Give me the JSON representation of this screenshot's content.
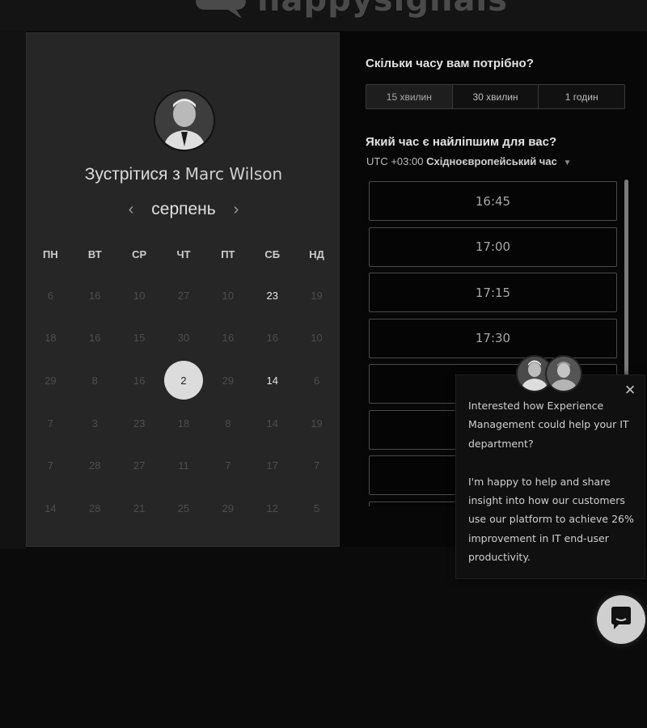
{
  "header": {
    "logo_text": "happysignals",
    "logo_icon": "speech-bubble-logo-icon"
  },
  "booking": {
    "title_prefix": "Зустрітися з",
    "host_name": "Marc Wilson",
    "month": "серпень",
    "prev_icon": "chevron-left-icon",
    "next_icon": "chevron-right-icon",
    "weekdays": [
      "ПН",
      "ВТ",
      "СР",
      "ЧТ",
      "ПТ",
      "СБ",
      "НД"
    ],
    "days": [
      {
        "label": "6",
        "state": "disabled"
      },
      {
        "label": "16",
        "state": "disabled"
      },
      {
        "label": "10",
        "state": "disabled"
      },
      {
        "label": "27",
        "state": "disabled"
      },
      {
        "label": "10",
        "state": "disabled"
      },
      {
        "label": "23",
        "state": "available"
      },
      {
        "label": "19",
        "state": "disabled"
      },
      {
        "label": "18",
        "state": "disabled"
      },
      {
        "label": "16",
        "state": "disabled"
      },
      {
        "label": "15",
        "state": "disabled"
      },
      {
        "label": "30",
        "state": "disabled"
      },
      {
        "label": "16",
        "state": "disabled"
      },
      {
        "label": "16",
        "state": "disabled"
      },
      {
        "label": "10",
        "state": "disabled"
      },
      {
        "label": "29",
        "state": "disabled"
      },
      {
        "label": "8",
        "state": "disabled"
      },
      {
        "label": "16",
        "state": "disabled"
      },
      {
        "label": "2",
        "state": "selected"
      },
      {
        "label": "29",
        "state": "disabled"
      },
      {
        "label": "14",
        "state": "available"
      },
      {
        "label": "6",
        "state": "disabled"
      },
      {
        "label": "7",
        "state": "disabled"
      },
      {
        "label": "3",
        "state": "disabled"
      },
      {
        "label": "23",
        "state": "disabled"
      },
      {
        "label": "18",
        "state": "disabled"
      },
      {
        "label": "8",
        "state": "disabled"
      },
      {
        "label": "14",
        "state": "disabled"
      },
      {
        "label": "19",
        "state": "disabled"
      },
      {
        "label": "7",
        "state": "disabled"
      },
      {
        "label": "28",
        "state": "disabled"
      },
      {
        "label": "27",
        "state": "disabled"
      },
      {
        "label": "11",
        "state": "disabled"
      },
      {
        "label": "7",
        "state": "disabled"
      },
      {
        "label": "17",
        "state": "disabled"
      },
      {
        "label": "7",
        "state": "disabled"
      },
      {
        "label": "14",
        "state": "disabled"
      },
      {
        "label": "28",
        "state": "disabled"
      },
      {
        "label": "21",
        "state": "disabled"
      },
      {
        "label": "25",
        "state": "disabled"
      },
      {
        "label": "29",
        "state": "disabled"
      },
      {
        "label": "12",
        "state": "disabled"
      },
      {
        "label": "5",
        "state": "disabled"
      }
    ]
  },
  "scheduler": {
    "duration_question": "Скільки часу вам потрібно?",
    "durations": [
      {
        "label": "15 хвилин",
        "active": true
      },
      {
        "label": "30 хвилин",
        "active": false
      },
      {
        "label": "1 годин",
        "active": false
      }
    ],
    "time_question": "Який час є найліпшим для вас?",
    "tz_offset": "UTC +03:00",
    "tz_name": "Східноєвропейський час",
    "time_slots": [
      "16:45",
      "17:00",
      "17:15",
      "17:30",
      "",
      "",
      "",
      ""
    ]
  },
  "chat": {
    "message_1": "Interested how Experience Management could help your IT department?",
    "message_2": "I'm happy to help and share insight into how our customers use our platform to achieve 26% improvement in IT end-user productivity.",
    "close_icon": "close-icon",
    "launcher_icon": "chat-bubble-icon"
  },
  "colors": {
    "background": "#0b0b0b",
    "panel": "#262626",
    "selected_day": "#dcdcdc",
    "launcher": "#cfcfcf"
  }
}
